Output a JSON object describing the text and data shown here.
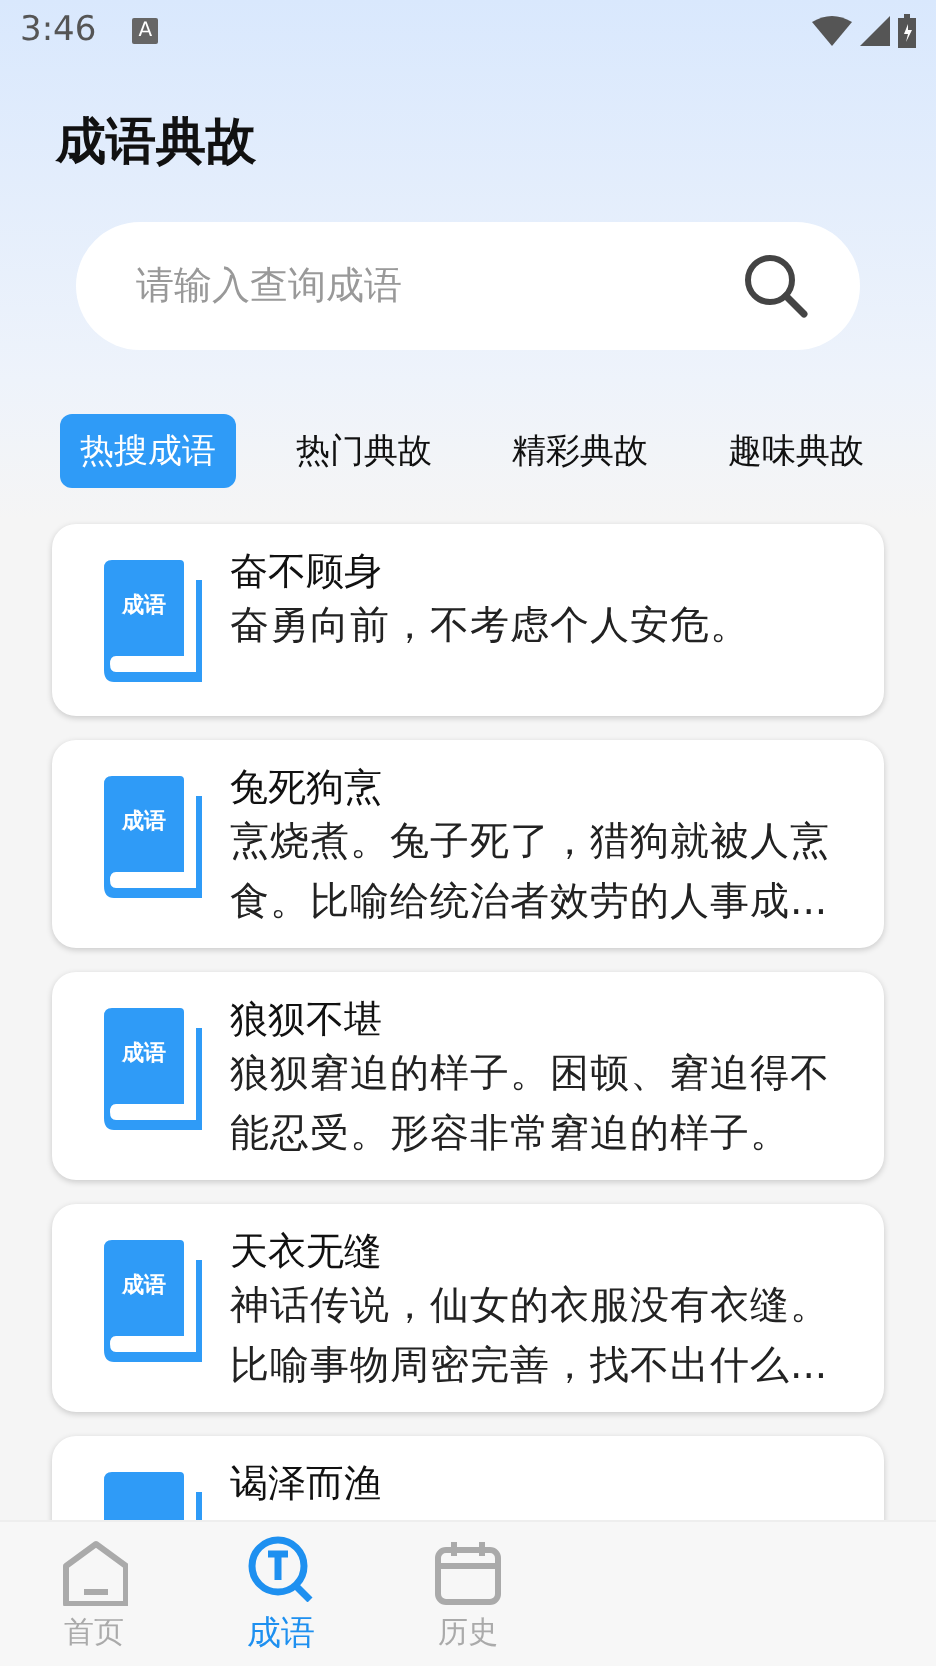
{
  "status_bar": {
    "time": "3:46",
    "notification_icon_letter": "A"
  },
  "header": {
    "title": "成语典故"
  },
  "search": {
    "placeholder": "请输入查询成语"
  },
  "tabs": [
    {
      "label": "热搜成语",
      "selected": true
    },
    {
      "label": "热门典故",
      "selected": false
    },
    {
      "label": "精彩典故",
      "selected": false
    },
    {
      "label": "趣味典故",
      "selected": false
    }
  ],
  "idioms": [
    {
      "icon_label": "成语",
      "title": "奋不顾身",
      "description": "奋勇向前，不考虑个人安危。"
    },
    {
      "icon_label": "成语",
      "title": "兔死狗烹",
      "description": "烹烧煮。兔子死了，猎狗就被人烹食。比喻给统治者效劳的人事成..."
    },
    {
      "icon_label": "成语",
      "title": "狼狈不堪",
      "description": "狼狈窘迫的样子。困顿、窘迫得不能忍受。形容非常窘迫的样子。"
    },
    {
      "icon_label": "成语",
      "title": "天衣无缝",
      "description": "神话传说，仙女的衣服没有衣缝。比喻事物周密完善，找不出什么..."
    },
    {
      "title": "谒泽而渔"
    }
  ],
  "bottom_nav": [
    {
      "label": "首页",
      "selected": false
    },
    {
      "label": "成语",
      "selected": true
    },
    {
      "label": "历史",
      "selected": false
    }
  ]
}
